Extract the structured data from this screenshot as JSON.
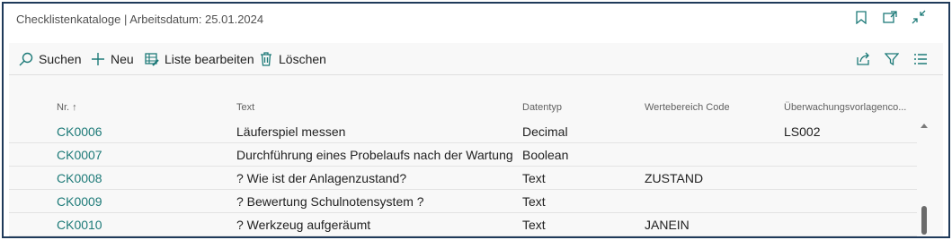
{
  "title": "Checklistenkataloge | Arbeitsdatum: 25.01.2024",
  "title_icons": [
    "bookmark-icon",
    "open-new-window-icon",
    "collapse-icon"
  ],
  "toolbar": {
    "search_label": "Suchen",
    "new_label": "Neu",
    "edit_list_label": "Liste bearbeiten",
    "delete_label": "Löschen",
    "right_icons": [
      "share-icon",
      "filter-icon",
      "list-view-icon"
    ]
  },
  "columns": {
    "no": "Nr. ↑",
    "text": "Text",
    "datatype": "Datentyp",
    "range_code": "Wertebereich Code",
    "monitoring": "Überwachungsvorlagenco..."
  },
  "rows": [
    {
      "no": "CK0006",
      "text": "Läuferspiel messen",
      "datatype": "Decimal",
      "range_code": "",
      "monitoring": "LS002"
    },
    {
      "no": "CK0007",
      "text": "Durchführung eines Probelaufs nach der Wartung",
      "datatype": "Boolean",
      "range_code": "",
      "monitoring": ""
    },
    {
      "no": "CK0008",
      "text": "? Wie ist der Anlagenzustand?",
      "datatype": "Text",
      "range_code": "ZUSTAND",
      "monitoring": ""
    },
    {
      "no": "CK0009",
      "text": "? Bewertung Schulnotensystem ?",
      "datatype": "Text",
      "range_code": "",
      "monitoring": ""
    },
    {
      "no": "CK0010",
      "text": "? Werkzeug aufgeräumt",
      "datatype": "Text",
      "range_code": "JANEIN",
      "monitoring": ""
    }
  ],
  "colors": {
    "accent": "#1d7a78",
    "border": "#1f3a5a"
  }
}
